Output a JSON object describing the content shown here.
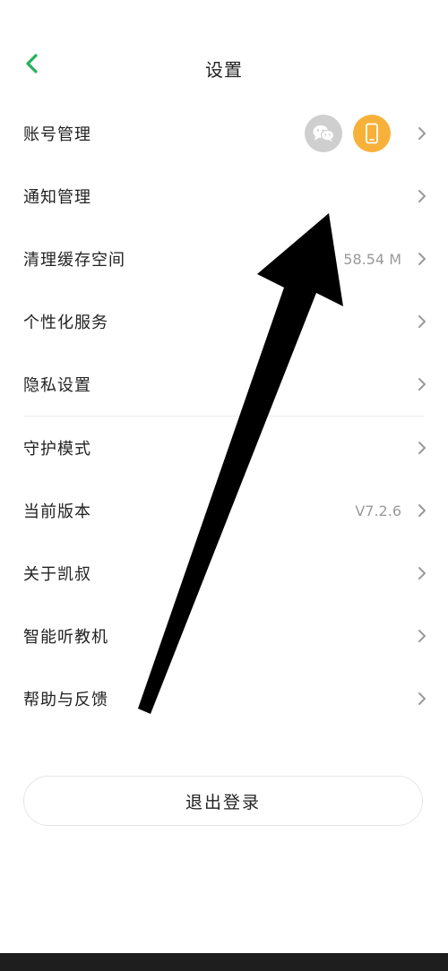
{
  "header": {
    "title": "设置",
    "back_icon": "chevron-left-icon"
  },
  "settings": {
    "account": {
      "label": "账号管理",
      "icons": [
        "wechat-icon",
        "phone-icon"
      ]
    },
    "notify": {
      "label": "通知管理"
    },
    "cache": {
      "label": "清理缓存空间",
      "value": "58.54 M"
    },
    "personal": {
      "label": "个性化服务"
    },
    "privacy": {
      "label": "隐私设置"
    },
    "guard": {
      "label": "守护模式"
    },
    "version": {
      "label": "当前版本",
      "value": "V7.2.6"
    },
    "about": {
      "label": "关于凯叔"
    },
    "smart": {
      "label": "智能听教机"
    },
    "help": {
      "label": "帮助与反馈"
    }
  },
  "logout": {
    "label": "退出登录"
  },
  "colors": {
    "accent_green": "#22b25a",
    "phone_orange": "#f7b13a",
    "wechat_gray": "#cfcfcf",
    "value_gray": "#9a9a9a"
  }
}
